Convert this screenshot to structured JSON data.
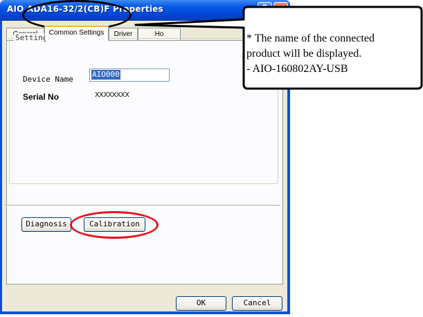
{
  "window": {
    "title": "AIO ADA16-32/2(CB)F Properties",
    "help_label": "?",
    "close_label": "✕"
  },
  "tabs": [
    {
      "label": "General"
    },
    {
      "label": "Common Settings"
    },
    {
      "label": "Driver"
    },
    {
      "label": "Ho"
    }
  ],
  "setting": {
    "group_label": "Setting",
    "device_name_label": "Device Name",
    "device_name_value": "AIO000",
    "serial_label": "Serial No",
    "serial_value": "XXXXXXXX"
  },
  "buttons": {
    "diagnosis": "Diagnosis",
    "calibration": "Calibration",
    "ok": "OK",
    "cancel": "Cancel"
  },
  "callout": {
    "line1": "* The name of the connected",
    "line2": "product will be displayed.",
    "line3": "- AIO-160802AY-USB"
  },
  "colors": {
    "title_bar": "#0a5ae8",
    "highlight_ellipse": "#e8101a",
    "selection": "#316ac5"
  }
}
